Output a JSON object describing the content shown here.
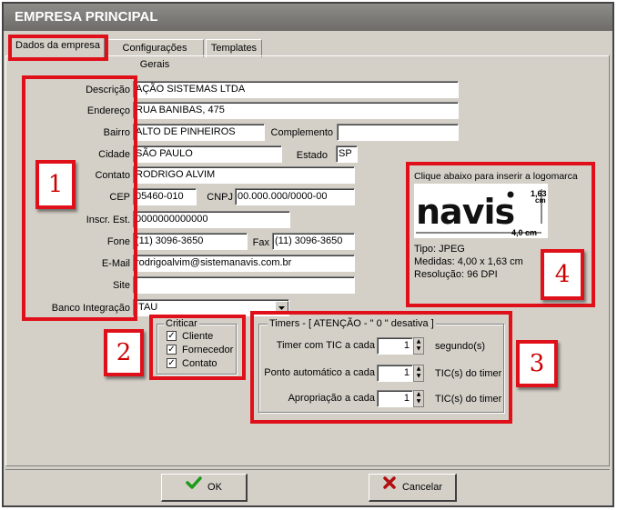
{
  "window": {
    "title": "EMPRESA PRINCIPAL"
  },
  "tabs": [
    {
      "label": "Dados da empresa",
      "active": true
    },
    {
      "label": "Configurações Gerais",
      "active": false
    },
    {
      "label": "Templates",
      "active": false
    }
  ],
  "form": {
    "descricao": {
      "label": "Descrição",
      "value": "AÇÃO SISTEMAS LTDA"
    },
    "endereco": {
      "label": "Endereço",
      "value": "RUA BANIBAS, 475"
    },
    "bairro": {
      "label": "Bairro",
      "value": "ALTO DE PINHEIROS"
    },
    "complemento": {
      "label": "Complemento",
      "value": ""
    },
    "cidade": {
      "label": "Cidade",
      "value": "SÃO PAULO"
    },
    "estado": {
      "label": "Estado",
      "value": "SP"
    },
    "contato": {
      "label": "Contato",
      "value": "RODRIGO ALVIM"
    },
    "cep": {
      "label": "CEP",
      "value": "05460-010"
    },
    "cnpj": {
      "label": "CNPJ",
      "value": "00.000.000/0000-00"
    },
    "inscr": {
      "label": "Inscr. Est.",
      "value": "0000000000000"
    },
    "fone": {
      "label": "Fone",
      "value": "(11) 3096-3650"
    },
    "fax": {
      "label": "Fax",
      "value": "(11) 3096-3650"
    },
    "email": {
      "label": "E-Mail",
      "value": "rodrigoalvim@sistemanavis.com.br"
    },
    "site": {
      "label": "Site",
      "value": ""
    },
    "banco": {
      "label": "Banco Integração",
      "value": "ITAU"
    }
  },
  "criticar": {
    "title": "Criticar",
    "items": [
      {
        "label": "Cliente",
        "checked": true
      },
      {
        "label": "Fornecedor",
        "checked": true
      },
      {
        "label": "Contato",
        "checked": true
      }
    ]
  },
  "timers": {
    "title": "Timers - [ ATENÇÃO - \" 0 \" desativa ]",
    "rows": [
      {
        "label": "Timer com TIC a cada",
        "value": "1",
        "unit": "segundo(s)"
      },
      {
        "label": "Ponto automático a cada",
        "value": "1",
        "unit": "TIC(s) do timer"
      },
      {
        "label": "Apropriação a cada",
        "value": "1",
        "unit": "TIC(s) do timer"
      }
    ]
  },
  "logo": {
    "caption": "Clique abaixo para inserir a logomarca",
    "brand": "navis",
    "height_dim": "1,63",
    "height_unit": "cm",
    "width_dim": "4,0 cm",
    "tipo": "Tipo: JPEG",
    "medidas": "Medidas: 4,00 x 1,63 cm",
    "resolucao": "Resolução: 96 DPI"
  },
  "badges": [
    "1",
    "2",
    "3",
    "4"
  ],
  "buttons": {
    "ok": "OK",
    "cancel": "Cancelar"
  },
  "colors": {
    "annotation_red": "#e0101a",
    "ok_green": "#1a9a1a",
    "cancel_red": "#b01010"
  }
}
